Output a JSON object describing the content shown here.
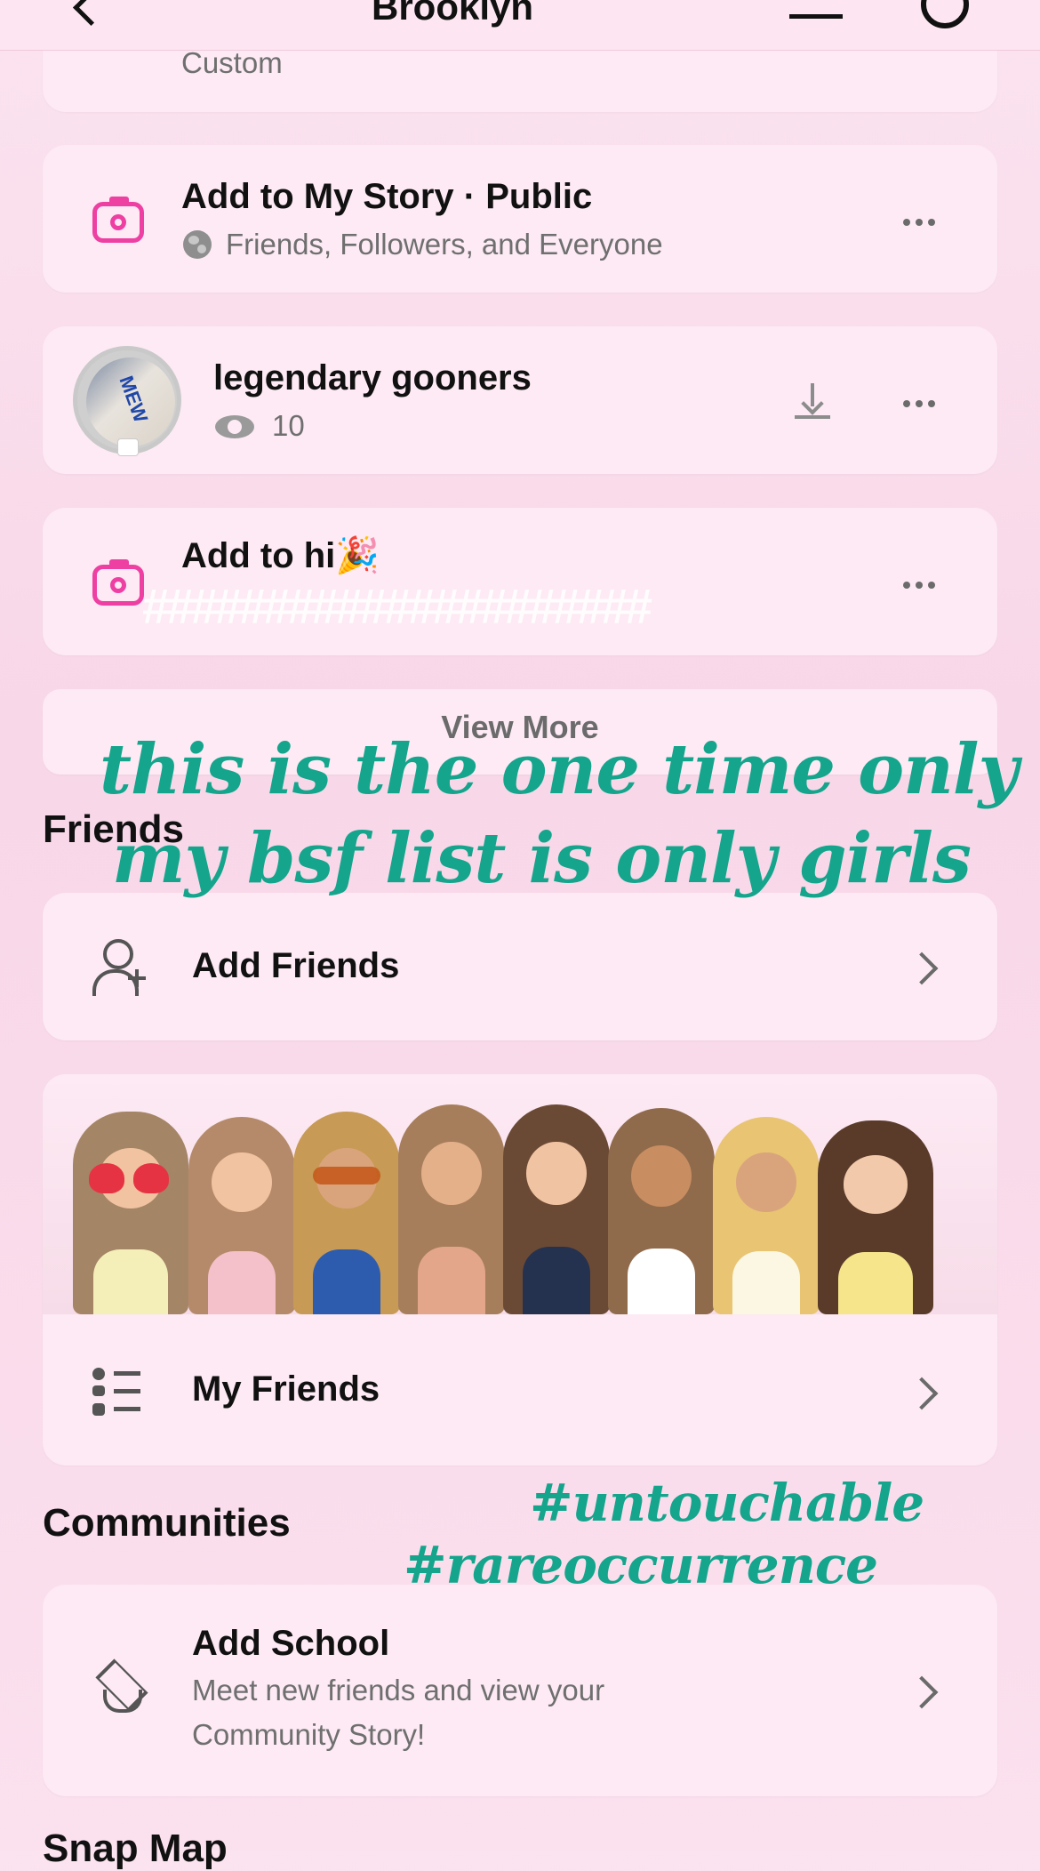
{
  "header": {
    "title": "Brooklyn"
  },
  "custom_row": {
    "subtitle": "Custom"
  },
  "story_public": {
    "title": "Add to My Story · Public",
    "subtitle": "Friends, Followers, and Everyone"
  },
  "story_private": {
    "title": "legendary gooners",
    "views": "10"
  },
  "story_other": {
    "title": "Add to hi🎉",
    "subtitle": "#####################"
  },
  "view_more": {
    "label": "View More"
  },
  "friends": {
    "heading": "Friends",
    "add_label": "Add Friends",
    "my_friends_label": "My Friends"
  },
  "communities": {
    "heading": "Communities",
    "school_title": "Add School",
    "school_sub_line1": "Meet new friends and view your",
    "school_sub_line2": "Community Story!"
  },
  "snap_map": {
    "heading": "Snap Map"
  },
  "overlay": {
    "line1": "this is the one time only",
    "line2": "my bsf list is only girls",
    "tag1": "#untouchable",
    "tag2": "#rareoccurrence"
  },
  "colors": {
    "accent": "#ee3fa3",
    "overlay_text": "#14a58c",
    "card_bg": "#fdeaf4"
  }
}
